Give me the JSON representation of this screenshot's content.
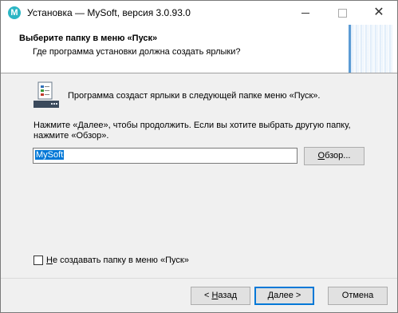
{
  "window": {
    "title": "Установка — MySoft, версия 3.0.93.0",
    "app_icon_letter": "M"
  },
  "header": {
    "title": "Выберите папку в меню «Пуск»",
    "subtitle": "Где программа установки должна создать ярлыки?"
  },
  "main": {
    "info": "Программа создаст ярлыки в следующей папке меню «Пуск».",
    "prompt": "Нажмите «Далее», чтобы продолжить. Если вы хотите выбрать другую папку, нажмите «Обзор».",
    "folder_value": "MySoft",
    "browse_accel": "О",
    "browse_rest": "бзор...",
    "no_folder_accel": "Н",
    "no_folder_rest": "е создавать папку в меню «Пуск»",
    "no_folder_checked": false
  },
  "footer": {
    "back_prefix": "< ",
    "back_accel": "Н",
    "back_rest": "азад",
    "next_accel": "Д",
    "next_rest": "алее >",
    "cancel_label": "Отмена"
  },
  "colors": {
    "accent": "#0078d7",
    "app_icon": "#2bb6c4"
  }
}
